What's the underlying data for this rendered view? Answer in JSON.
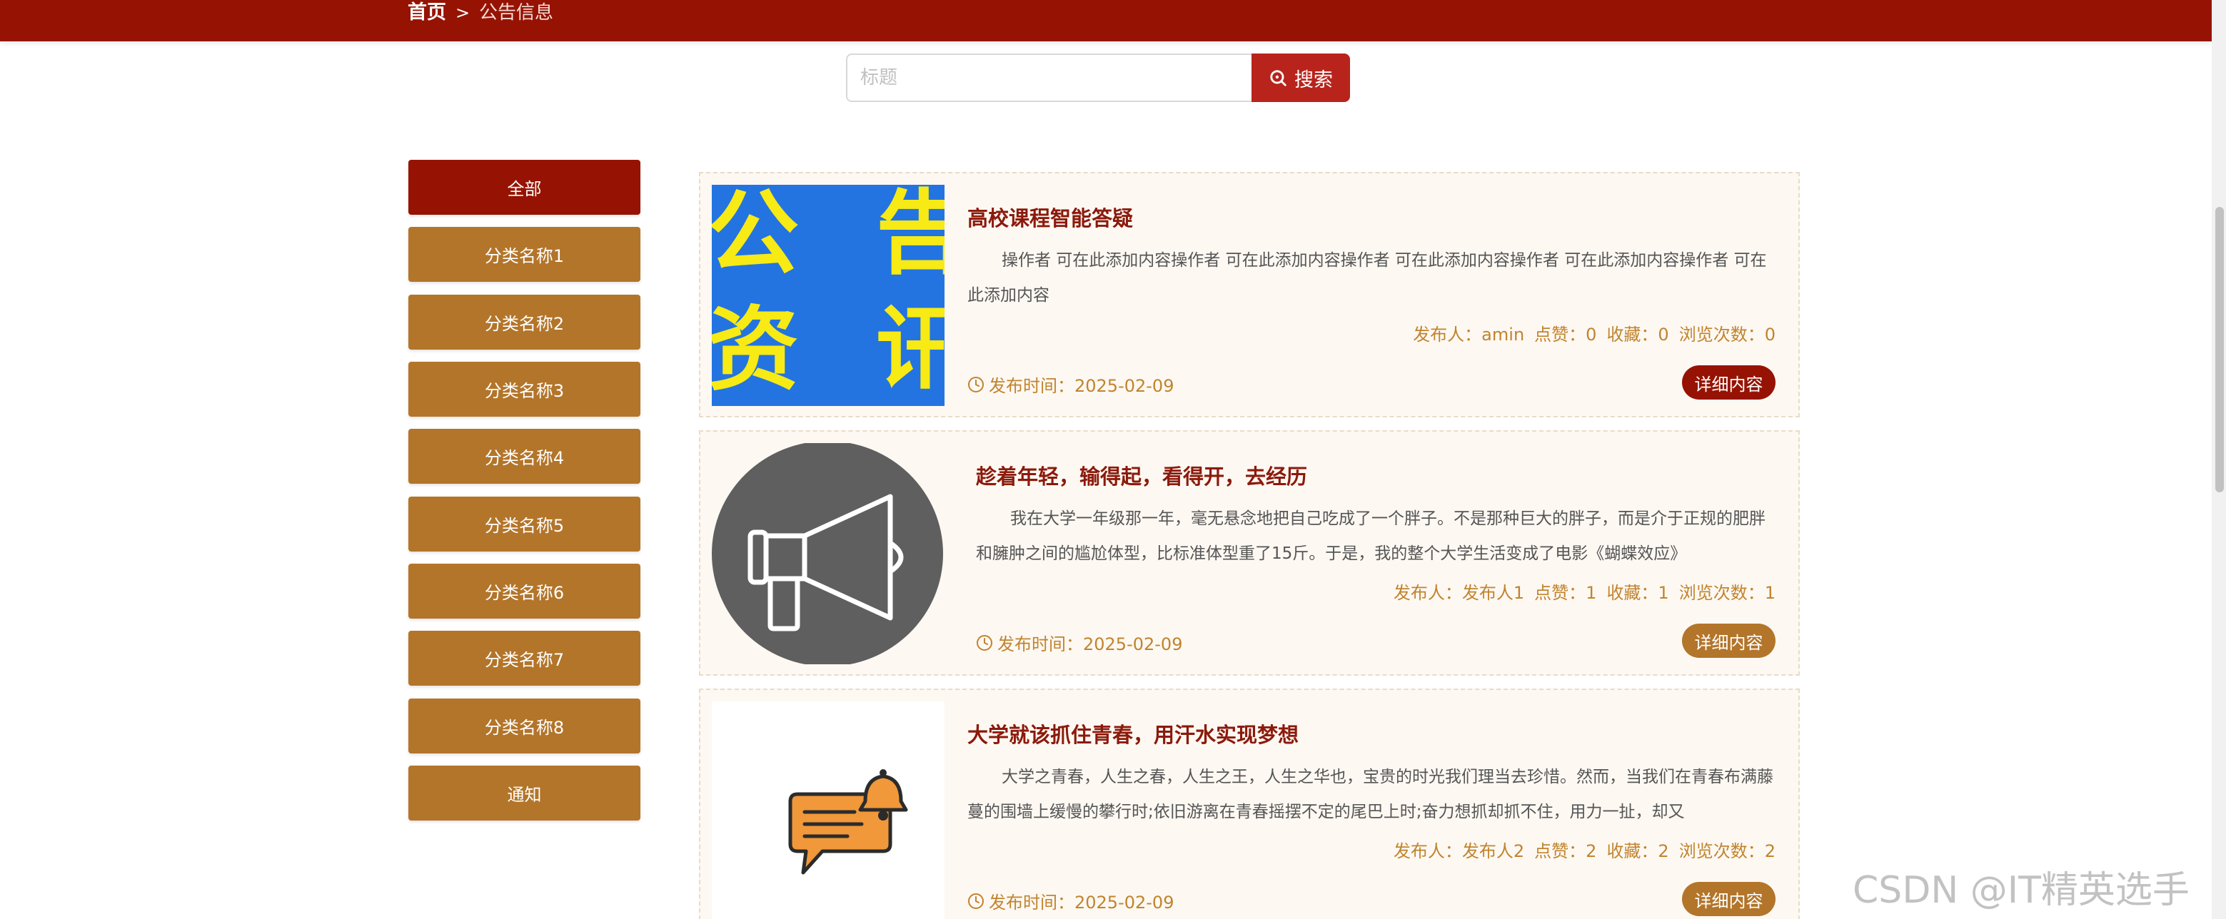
{
  "breadcrumb": {
    "home": "首页",
    "separator": ">",
    "current": "公告信息"
  },
  "search": {
    "placeholder": "标题",
    "button_label": "搜索",
    "button_icon": "search-icon"
  },
  "sidebar": {
    "items": [
      {
        "label": "全部",
        "active": true
      },
      {
        "label": "分类名称1",
        "active": false
      },
      {
        "label": "分类名称2",
        "active": false
      },
      {
        "label": "分类名称3",
        "active": false
      },
      {
        "label": "分类名称4",
        "active": false
      },
      {
        "label": "分类名称5",
        "active": false
      },
      {
        "label": "分类名称6",
        "active": false
      },
      {
        "label": "分类名称7",
        "active": false
      },
      {
        "label": "分类名称8",
        "active": false
      },
      {
        "label": "通知",
        "active": false
      }
    ]
  },
  "notices": [
    {
      "image_text": [
        "公",
        "告",
        "资",
        "讯"
      ],
      "title": "高校课程智能答疑",
      "content": "操作者 可在此添加内容操作者 可在此添加内容操作者 可在此添加内容操作者 可在此添加内容操作者 可在此添加内容",
      "publisher_label": "发布人：amin",
      "likes_label": "点赞：0",
      "favorites_label": "收藏：0",
      "views_label": "浏览次数：0",
      "time_label": "发布时间：2025-02-09",
      "detail_label": "详细内容"
    },
    {
      "title": "趁着年轻，输得起，看得开，去经历",
      "content": "我在大学一年级那一年，毫无悬念地把自己吃成了一个胖子。不是那种巨大的胖子，而是介于正规的肥胖和臃肿之间的尴尬体型，比标准体型重了15斤。于是，我的整个大学生活变成了电影《蝴蝶效应》",
      "publisher_label": "发布人：发布人1",
      "likes_label": "点赞：1",
      "favorites_label": "收藏：1",
      "views_label": "浏览次数：1",
      "time_label": "发布时间：2025-02-09",
      "detail_label": "详细内容"
    },
    {
      "title": "大学就该抓住青春，用汗水实现梦想",
      "content": "大学之青春，人生之春，人生之王，人生之华也，宝贵的时光我们理当去珍惜。然而，当我们在青春布满藤蔓的围墙上缓慢的攀行时;依旧游离在青春摇摆不定的尾巴上时;奋力想抓却抓不住，用力一扯，却又",
      "publisher_label": "发布人：发布人2",
      "likes_label": "点赞：2",
      "favorites_label": "收藏：2",
      "views_label": "浏览次数：2",
      "time_label": "发布时间：2025-02-09",
      "detail_label": "详细内容"
    }
  ],
  "watermark": "CSDN @IT精英选手",
  "colors": {
    "primary": "#961303",
    "gold": "#b3752a",
    "meta": "#c1842e"
  }
}
